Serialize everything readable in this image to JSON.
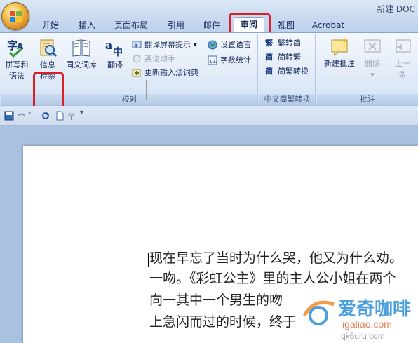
{
  "window": {
    "title": "新建 DOC"
  },
  "tabs": {
    "home": "开始",
    "insert": "插入",
    "layout": "页面布局",
    "references": "引用",
    "mailings": "邮件",
    "review": "审阅",
    "view": "视图",
    "acrobat": "Acrobat"
  },
  "ribbon": {
    "proofing": {
      "group_label": "校对",
      "spelling": {
        "line1": "拼写和",
        "line2": "语法"
      },
      "research": {
        "line1": "信息",
        "line2": "检索"
      },
      "thesaurus": "同义词库",
      "translate": "翻译",
      "translate_tooltip": "翻译屏幕提示",
      "english_assistant": "英语助手",
      "update_ime": "更新输入法词典",
      "set_language": "设置语言",
      "word_count": "字数统计"
    },
    "chinese": {
      "group_label": "中文简繁转换",
      "t2s": "繁转简",
      "s2t": "简转繁",
      "convert": "简繁转换"
    },
    "comments": {
      "group_label": "批注",
      "new_comment": "新建批注",
      "delete": "删除",
      "previous": {
        "line1": "上一",
        "line2": "条"
      }
    }
  },
  "document": {
    "lines": [
      "现在早忘了当时为什么哭，他又为什么劝。",
      "一吻。《彩虹公主》里的主人公小姐在两个",
      "向一其中一个男生的吻",
      "上急闪而过的时候，终于"
    ]
  },
  "watermark": {
    "brand": "爱奇咖啡",
    "site": "igaliao.com",
    "site2": "qk6uru.com"
  },
  "colors": {
    "highlight": "#d8202a",
    "ribbon_bg": "#e3ecf8",
    "doc_bg": "#a9c2e2"
  }
}
